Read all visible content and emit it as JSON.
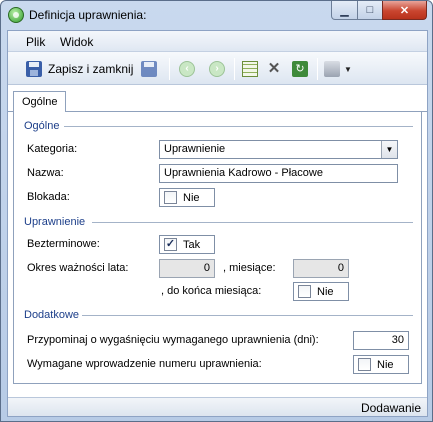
{
  "window": {
    "title": "Definicja uprawnienia:"
  },
  "menu": {
    "items": [
      {
        "label": "Plik"
      },
      {
        "label": "Widok"
      }
    ]
  },
  "toolbar": {
    "save_close_label": "Zapisz i zamknij"
  },
  "tabs": [
    {
      "label": "Ogólne"
    }
  ],
  "sections": {
    "ogolne": {
      "title": "Ogólne",
      "kategoria_label": "Kategoria:",
      "kategoria_value": "Uprawnienie",
      "nazwa_label": "Nazwa:",
      "nazwa_value": "Uprawnienia Kadrowo - Płacowe",
      "blokada_label": "Blokada:",
      "blokada_value": "Nie"
    },
    "uprawnienie": {
      "title": "Uprawnienie",
      "bezterminowe_label": "Bezterminowe:",
      "bezterminowe_value": "Tak",
      "okres_label": "Okres ważności lata:",
      "lata_value": "0",
      "miesiace_label": ", miesiące:",
      "miesiace_value": "0",
      "do_konca_label": ", do końca miesiąca:",
      "do_konca_value": "Nie"
    },
    "dodatkowe": {
      "title": "Dodatkowe",
      "przypominaj_label": "Przypominaj o wygaśnięciu wymaganego uprawnienia (dni):",
      "przypominaj_value": "30",
      "wymagane_label": "Wymagane wprowadzenie numeru uprawnienia:",
      "wymagane_value": "Nie"
    }
  },
  "status": {
    "text": "Dodawanie"
  }
}
